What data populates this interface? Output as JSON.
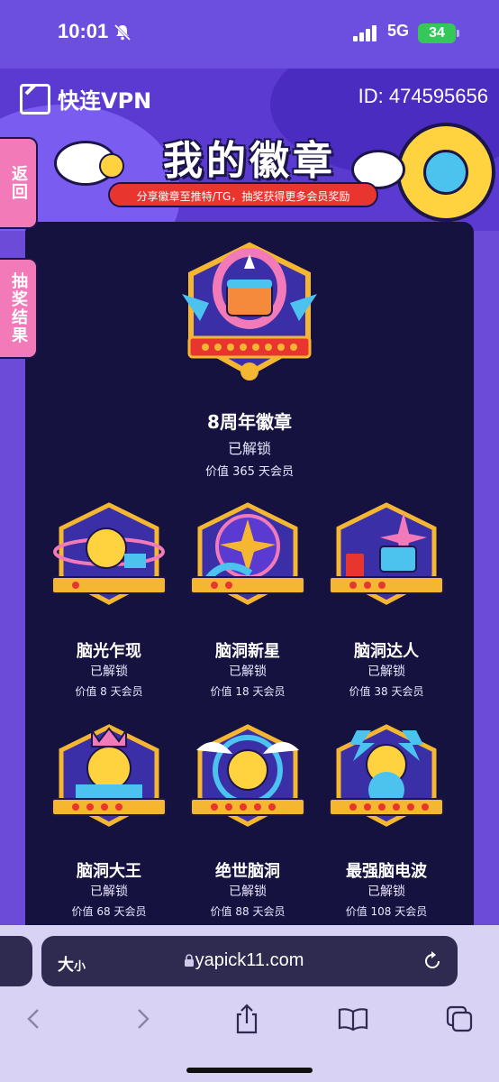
{
  "status_bar": {
    "time": "10:01",
    "network": "5G",
    "battery": "34"
  },
  "header": {
    "app_name": "快连VPN",
    "user_id": "ID: 474595656",
    "title": "我的徽章",
    "subtitle": "分享徽章至推特/TG，抽奖获得更多会员奖励"
  },
  "side_tabs": {
    "back": "返回",
    "lottery": "抽奖结果"
  },
  "featured_badge": {
    "name": "8周年徽章",
    "status": "已解锁",
    "value": "价值 365 天会员"
  },
  "badges": [
    {
      "name": "脑光乍现",
      "status": "已解锁",
      "value": "价值 8 天会员"
    },
    {
      "name": "脑洞新星",
      "status": "已解锁",
      "value": "价值 18 天会员"
    },
    {
      "name": "脑洞达人",
      "status": "已解锁",
      "value": "价值 38 天会员"
    },
    {
      "name": "脑洞大王",
      "status": "已解锁",
      "value": "价值 68 天会员"
    },
    {
      "name": "绝世脑洞",
      "status": "已解锁",
      "value": "价值 88 天会员"
    },
    {
      "name": "最强脑电波",
      "status": "已解锁",
      "value": "价值 108 天会员"
    }
  ],
  "browser": {
    "text_size": "大",
    "text_size_small": "小",
    "url": "yapick11.com"
  },
  "colors": {
    "accent": "#6c4bd9",
    "panel": "#15123f",
    "pink": "#f27ab8",
    "gold": "#f5b731",
    "red": "#e8362e"
  }
}
